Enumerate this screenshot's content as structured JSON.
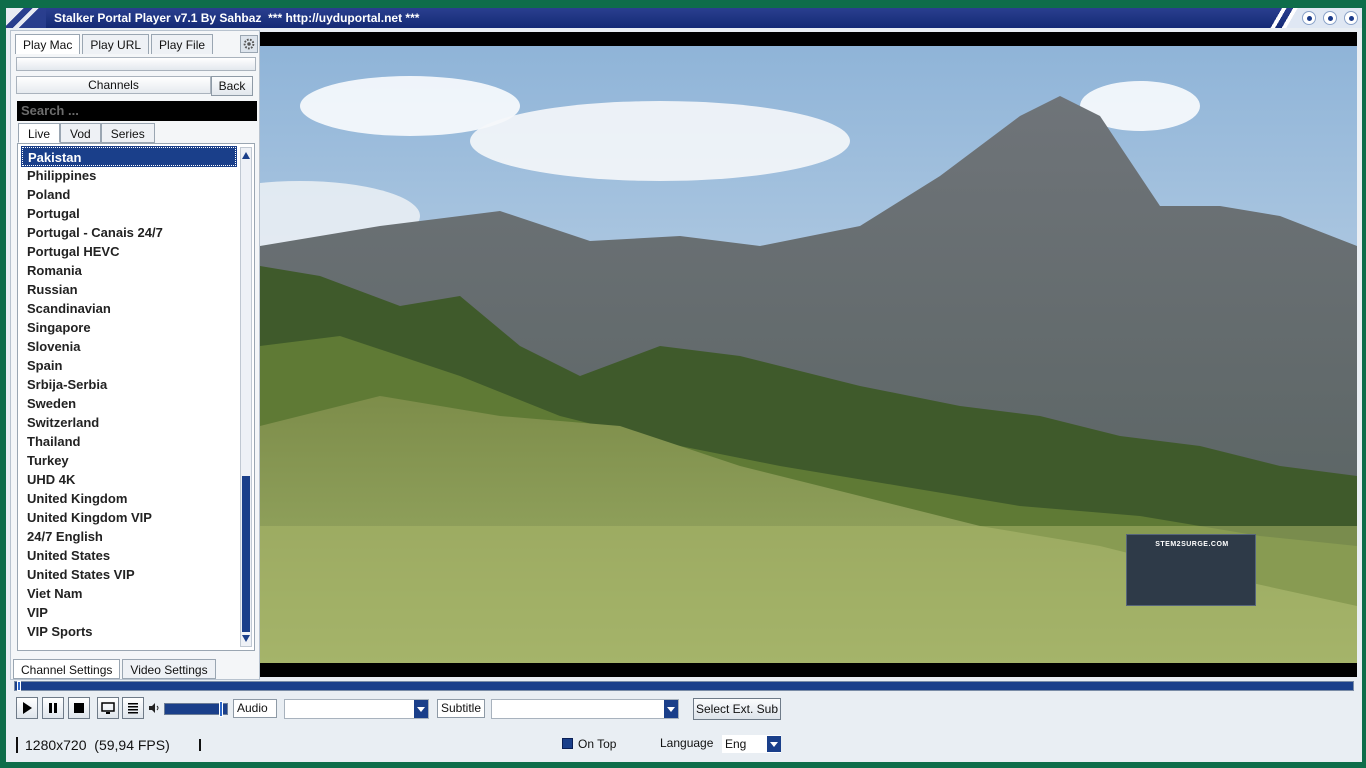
{
  "window": {
    "title": "Stalker Portal Player v7.1 By Sahbaz  *** http://uyduportal.net ***"
  },
  "left_panel": {
    "tabs": [
      {
        "label": "Play Mac",
        "active": true
      },
      {
        "label": "Play URL",
        "active": false
      },
      {
        "label": "Play File",
        "active": false
      }
    ],
    "channels_header": "Channels",
    "back_label": "Back",
    "search_placeholder": "Search ...",
    "sub_tabs": [
      {
        "label": "Live",
        "active": true
      },
      {
        "label": "Vod",
        "active": false
      },
      {
        "label": "Series",
        "active": false
      }
    ],
    "channel_list": [
      "Pakistan",
      "Philippines",
      "Poland",
      "Portugal",
      "Portugal - Canais 24/7",
      "Portugal HEVC",
      "Romania",
      "Russian",
      "Scandinavian",
      "Singapore",
      "Slovenia",
      "Spain",
      "Srbija-Serbia",
      "Sweden",
      "Switzerland",
      "Thailand",
      "Turkey",
      "UHD 4K",
      "United Kingdom",
      "United Kingdom VIP",
      "24/7 English",
      "United States",
      "United States VIP",
      "Viet Nam",
      "VIP",
      "VIP Sports"
    ],
    "selected_channel": "Pakistan",
    "bottom_tabs": [
      {
        "label": "Channel Settings",
        "active": true
      },
      {
        "label": "Video Settings",
        "active": false
      }
    ]
  },
  "video": {
    "overlay_text": "STEM2SURGE.COM",
    "progress_fraction": 0.0
  },
  "controls": {
    "audio_label": "Audio",
    "audio_value": "",
    "subtitle_label": "Subtitle",
    "subtitle_value": "",
    "select_ext_sub_label": "Select Ext. Sub",
    "volume_fraction": 0.92
  },
  "status": {
    "resolution": "1280x720",
    "fps": "(59,94 FPS)",
    "on_top_label": "On Top",
    "on_top_checked": true,
    "language_label": "Language",
    "language_value": "Eng"
  },
  "colors": {
    "accent": "#1a3f8a",
    "frame_green": "#0e6d4a",
    "titlebar": "#142a75"
  }
}
